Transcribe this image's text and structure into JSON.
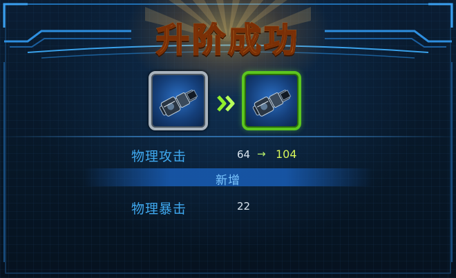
{
  "title": "升阶成功",
  "equipment": {
    "before_icon": "cannon-weapon-icon",
    "after_icon": "cannon-weapon-icon",
    "transition_icon": "double-chevron-right-icon"
  },
  "stats": [
    {
      "label": "物理攻击",
      "old_value": "64",
      "arrow": "→",
      "new_value": "104"
    }
  ],
  "new_section_label": "新增",
  "new_stats": [
    {
      "label": "物理暴击",
      "value": "22"
    }
  ],
  "colors": {
    "title_gold": "#ffd35a",
    "stat_label_blue": "#3fa9f0",
    "new_value_green": "#d7f55a",
    "new_slot_border": "#5cc61f",
    "old_slot_border": "#a9b3bd"
  }
}
